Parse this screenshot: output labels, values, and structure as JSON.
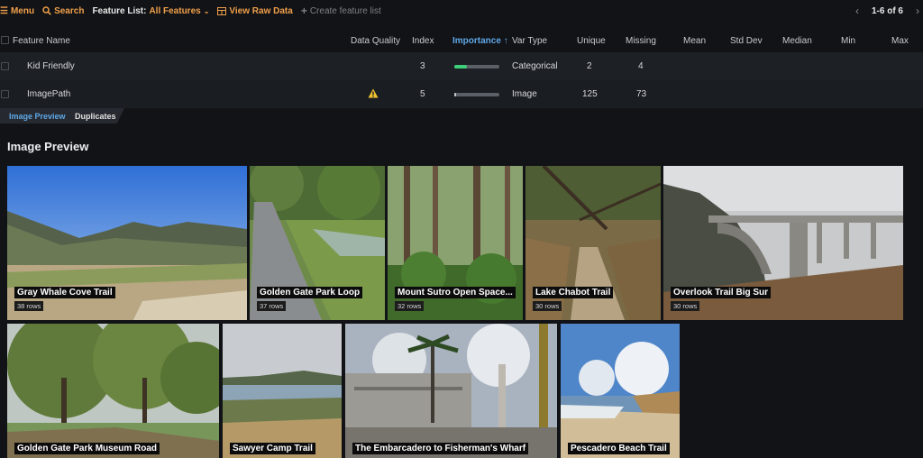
{
  "toolbar": {
    "menu_label": "Menu",
    "search_label": "Search",
    "feature_list_label": "Feature List:",
    "feature_list_value": "All Features",
    "view_raw_label": "View Raw Data",
    "create_list_label": "Create feature list",
    "pagination_text": "1-6 of 6"
  },
  "colors": {
    "accent_orange": "#f0a04b",
    "accent_blue": "#5fa8e8",
    "importance_green": "#3ecf7a",
    "warning_yellow": "#f2c230"
  },
  "table": {
    "columns": [
      "Feature Name",
      "Data Quality",
      "Index",
      "Importance",
      "Var Type",
      "Unique",
      "Missing",
      "Mean",
      "Std Dev",
      "Median",
      "Min",
      "Max"
    ],
    "sort_indicator": "↑",
    "rows": [
      {
        "name": "Kid Friendly",
        "quality_icon": "",
        "index": "3",
        "importance": 0.28,
        "var_type": "Categorical",
        "unique": "2",
        "missing": "4"
      },
      {
        "name": "ImagePath",
        "quality_icon": "warning-icon",
        "index": "5",
        "importance": 0.04,
        "var_type": "Image",
        "unique": "125",
        "missing": "73"
      }
    ]
  },
  "subtabs": [
    {
      "label": "Image Preview",
      "active": true
    },
    {
      "label": "Duplicates",
      "active": false
    }
  ],
  "preview": {
    "title": "Image Preview",
    "tiles": [
      {
        "label": "Gray Whale Cove Trail",
        "rows": "38 rows"
      },
      {
        "label": "Golden Gate Park Loop",
        "rows": "37 rows"
      },
      {
        "label": "Mount Sutro Open Space...",
        "rows": "32 rows"
      },
      {
        "label": "Lake Chabot Trail",
        "rows": "30 rows"
      },
      {
        "label": "Overlook Trail Big Sur",
        "rows": "30 rows"
      },
      {
        "label": "Golden Gate Park Museum Road",
        "rows": ""
      },
      {
        "label": "Sawyer Camp Trail",
        "rows": ""
      },
      {
        "label": "The Embarcadero to Fisherman's Wharf",
        "rows": ""
      },
      {
        "label": "Pescadero Beach Trail",
        "rows": ""
      }
    ]
  }
}
